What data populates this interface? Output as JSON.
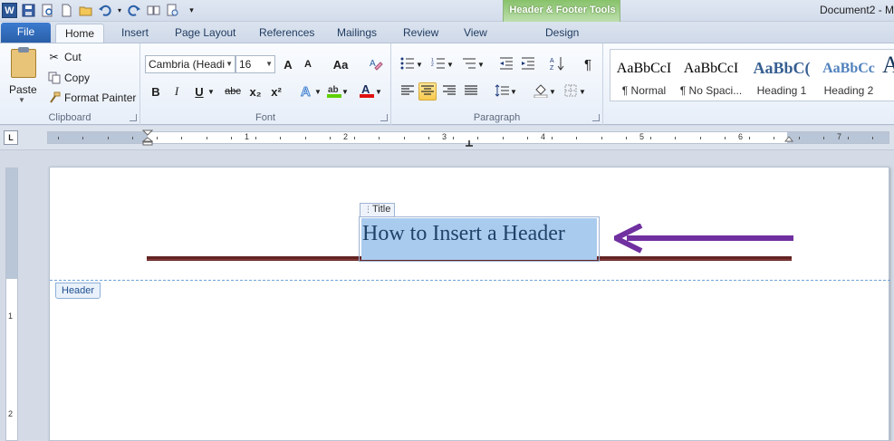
{
  "window": {
    "document_title": "Document2 - M"
  },
  "contextual_group": {
    "label": "Header & Footer Tools",
    "tab": "Design"
  },
  "tabs": [
    {
      "label": "File"
    },
    {
      "label": "Home"
    },
    {
      "label": "Insert"
    },
    {
      "label": "Page Layout"
    },
    {
      "label": "References"
    },
    {
      "label": "Mailings"
    },
    {
      "label": "Review"
    },
    {
      "label": "View"
    }
  ],
  "clipboard": {
    "paste_label": "Paste",
    "cut_label": "Cut",
    "copy_label": "Copy",
    "format_painter_label": "Format Painter",
    "group_label": "Clipboard"
  },
  "font": {
    "font_name": "Cambria (Headi",
    "font_size": "16",
    "group_label": "Font",
    "bold": "B",
    "italic": "I",
    "underline": "U",
    "strikethrough": "abc",
    "subscript": "x₂",
    "superscript": "x²",
    "grow": "A",
    "shrink": "A",
    "change_case": "Aa"
  },
  "paragraph": {
    "group_label": "Paragraph",
    "show_marks": "¶"
  },
  "styles": [
    {
      "sample": "AaBbCcI",
      "name": "¶ Normal"
    },
    {
      "sample": "AaBbCcI",
      "name": "¶ No Spaci..."
    },
    {
      "sample": "AaBbC(",
      "name": "Heading 1"
    },
    {
      "sample": "AaBbCc",
      "name": "Heading 2"
    }
  ],
  "ruler": {
    "toggle_label": "L",
    "numbers": [
      "1",
      "2",
      "3",
      "4",
      "5",
      "6",
      "7"
    ],
    "vertical_numbers": [
      "1",
      "2"
    ]
  },
  "document": {
    "title_control_tag": "Title",
    "title_text": "How to Insert a Header",
    "header_tag": "Header"
  },
  "colors": {
    "accent_arrow": "#7030a0",
    "header_rule": "#622423",
    "selection": "#a9cbee"
  }
}
